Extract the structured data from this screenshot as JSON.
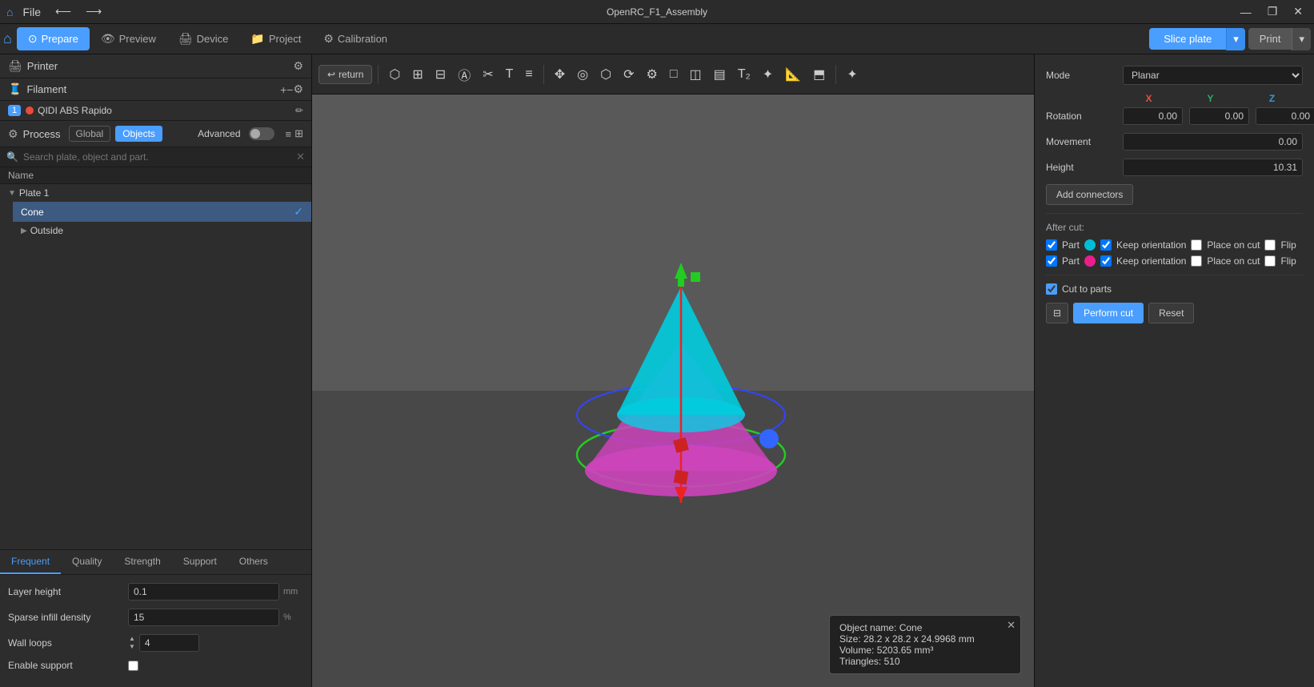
{
  "titlebar": {
    "title": "OpenRC_F1_Assembly",
    "file_menu": "File",
    "undo": "⟵",
    "redo": "⟶",
    "minimize": "—",
    "restore": "❐",
    "close": "✕"
  },
  "nav": {
    "tabs": [
      {
        "id": "prepare",
        "label": "Prepare",
        "icon": "⊙",
        "active": true
      },
      {
        "id": "preview",
        "label": "Preview",
        "icon": "👁",
        "active": false
      },
      {
        "id": "device",
        "label": "Device",
        "icon": "🖨",
        "active": false
      },
      {
        "id": "project",
        "label": "Project",
        "icon": "📁",
        "active": false
      },
      {
        "id": "calibration",
        "label": "Calibration",
        "icon": "⚙",
        "active": false
      }
    ],
    "slice_label": "Slice plate",
    "print_label": "Print"
  },
  "left": {
    "printer": {
      "icon": "🖨",
      "label": "Printer",
      "gear_icon": "⚙"
    },
    "filament": {
      "icon": "🧵",
      "label": "Filament",
      "num": "1",
      "name": "QIDI ABS Rapido",
      "add_icon": "+",
      "remove_icon": "−",
      "gear_icon": "⚙",
      "edit_icon": "✏"
    },
    "process": {
      "icon": "⚙",
      "label": "Process",
      "global_label": "Global",
      "objects_label": "Objects",
      "advanced_label": "Advanced",
      "list_icon": "≡",
      "grid_icon": "⊞"
    },
    "search_placeholder": "Search plate, object and part.",
    "tree": {
      "plate": "Plate 1",
      "cone": "Cone",
      "outside": "Outside"
    },
    "tabs": [
      {
        "id": "frequent",
        "label": "Frequent",
        "active": true
      },
      {
        "id": "quality",
        "label": "Quality",
        "active": false
      },
      {
        "id": "strength",
        "label": "Strength",
        "active": false
      },
      {
        "id": "support",
        "label": "Support",
        "active": false
      },
      {
        "id": "others",
        "label": "Others",
        "active": false
      }
    ],
    "settings": {
      "layer_height": {
        "label": "Layer height",
        "value": "0.1",
        "unit": "mm"
      },
      "sparse_infill": {
        "label": "Sparse infill density",
        "value": "15",
        "unit": "%"
      },
      "wall_loops": {
        "label": "Wall loops",
        "value": "4",
        "unit": ""
      },
      "enable_support": {
        "label": "Enable support",
        "checked": false
      }
    }
  },
  "right": {
    "mode_label": "Mode",
    "mode_value": "Planar",
    "axes": {
      "x_label": "X",
      "y_label": "Y",
      "z_label": "Z"
    },
    "rotation_label": "Rotation",
    "rotation_x": "0.00",
    "rotation_y": "0.00",
    "rotation_z": "0.00",
    "movement_label": "Movement",
    "movement_value": "0.00",
    "height_label": "Height",
    "height_value": "10.31",
    "add_connectors_label": "Add connectors",
    "after_cut_label": "After cut:",
    "part_label": "Part",
    "keep_orientation_label": "Keep orientation",
    "place_on_cut_label": "Place on cut",
    "flip_label": "Flip",
    "cut_to_parts_label": "Cut to parts",
    "perform_cut_label": "Perform cut",
    "reset_label": "Reset"
  },
  "info_box": {
    "name_label": "Object name: Cone",
    "size_label": "Size: 28.2 x 28.2 x 24.9968 mm",
    "volume_label": "Volume: 5203.65 mm³",
    "triangles_label": "Triangles: 510",
    "close_icon": "✕"
  },
  "toolbar": {
    "return_label": "return"
  },
  "icons": {
    "home": "⌂",
    "grid": "⊞",
    "layers": "≡",
    "auto": "A",
    "cut": "✂",
    "select": "↖",
    "brush": "✏",
    "lasso": "◌",
    "rotate": "↻",
    "settings2": "⚙",
    "box": "□",
    "box2": "◧",
    "stack": "▣",
    "text": "T",
    "paint": "🖌",
    "ruler": "📐",
    "flatten": "⬒",
    "cursor": "✦"
  }
}
